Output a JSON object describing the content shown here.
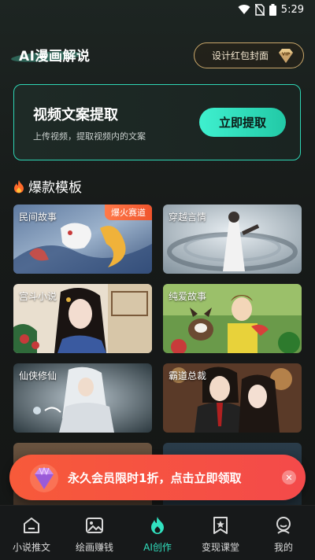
{
  "status_bar": {
    "time": "5:29",
    "icons": [
      "wifi-icon",
      "no-sim-icon",
      "battery-icon"
    ]
  },
  "header": {
    "title": "AI漫画解说",
    "cover_button": "设计红包封面",
    "vip_icon": "vip-diamond-icon"
  },
  "extract_card": {
    "title": "视频文案提取",
    "subtitle": "上传视频，提取视频内的文案",
    "button": "立即提取"
  },
  "section": {
    "icon": "fire-icon",
    "title": "爆款模板"
  },
  "templates": [
    {
      "label": "民间故事",
      "badge": "爆火赛道"
    },
    {
      "label": "穿越言情"
    },
    {
      "label": "宫斗小说"
    },
    {
      "label": "纯爱故事"
    },
    {
      "label": "仙侠修仙"
    },
    {
      "label": "霸道总裁"
    }
  ],
  "promo": {
    "text": "永久会员限时1折，点击立即领取",
    "close": "✕"
  },
  "bottom_nav": [
    {
      "label": "小说推文",
      "icon": "house-icon",
      "active": false
    },
    {
      "label": "绘画赚钱",
      "icon": "image-icon",
      "active": false
    },
    {
      "label": "AI创作",
      "icon": "ai-flame-icon",
      "active": true
    },
    {
      "label": "变现课堂",
      "icon": "star-bookmark-icon",
      "active": false
    },
    {
      "label": "我的",
      "icon": "profile-icon",
      "active": false
    }
  ],
  "colors": {
    "accent": "#31e2c0",
    "badge": "#f0542c",
    "promo": "#f44a4a",
    "gold": "#c9a76a"
  }
}
